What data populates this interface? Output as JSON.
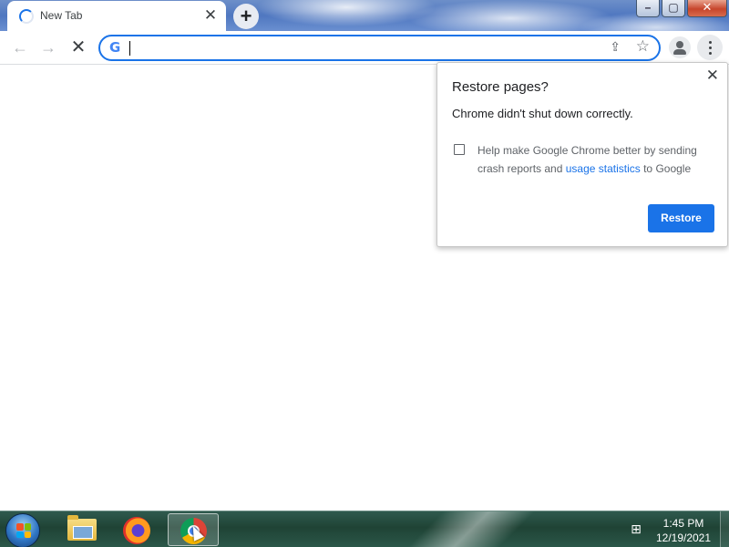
{
  "browser": {
    "tab": {
      "title": "New Tab",
      "close_glyph": "✕"
    },
    "new_tab_glyph": "+",
    "window_controls": {
      "minimize": "–",
      "maximize": "▢",
      "close": "✕"
    },
    "toolbar": {
      "back_glyph": "←",
      "forward_glyph": "→",
      "stop_glyph": "✕"
    },
    "omnibox": {
      "logo": "G",
      "value": "",
      "placeholder": ""
    },
    "omnibox_icons": {
      "share": "⇪",
      "star": "☆"
    }
  },
  "dialog": {
    "title": "Restore pages?",
    "message": "Chrome didn't shut down correctly.",
    "checkbox_checked": false,
    "checkbox_text_before": "Help make Google Chrome better by sending crash reports and ",
    "checkbox_link": "usage statistics",
    "checkbox_text_after": " to Google",
    "restore_label": "Restore",
    "close_glyph": "✕"
  },
  "taskbar": {
    "apps": [
      "Windows Explorer",
      "Firefox",
      "Google Chrome"
    ],
    "tray_network_glyph": "⊞",
    "clock_time": "1:45 PM",
    "clock_date": "12/19/2021"
  },
  "colors": {
    "accent": "#1a73e8",
    "link": "#1a73e8",
    "taskbar": "#1f4335"
  }
}
